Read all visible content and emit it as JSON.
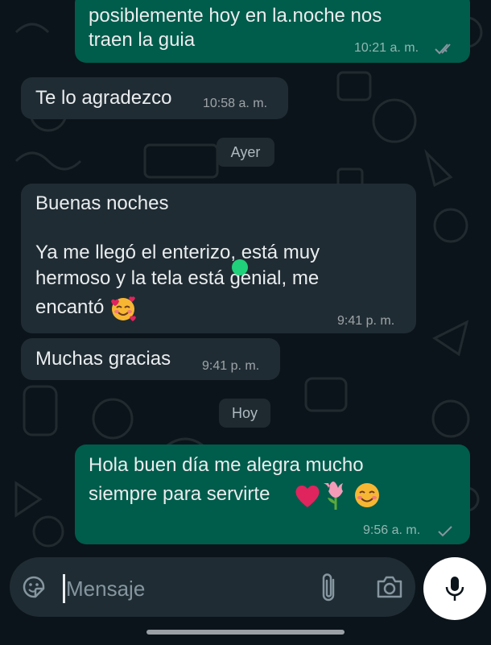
{
  "messages": [
    {
      "lines": [
        "posiblemente hoy en la.noche nos",
        "traen la guia"
      ],
      "time": "10:21 a. m.",
      "direction": "outgoing",
      "status": "read"
    },
    {
      "lines": [
        "Te lo agradezco"
      ],
      "time": "10:58 a. m.",
      "direction": "incoming"
    },
    {
      "lines": [
        "Buenas noches",
        "",
        "Ya me llegó el enterizo, está muy",
        "hermoso y la tela está genial, me",
        "encantó"
      ],
      "emoji": "smiling-face-with-hearts",
      "time": "9:41 p. m.",
      "direction": "incoming"
    },
    {
      "lines": [
        "Muchas gracias"
      ],
      "time": "9:41 p. m.",
      "direction": "incoming"
    },
    {
      "lines": [
        "Hola buen día me alegra mucho",
        "siempre para servirte"
      ],
      "emojis": [
        "red-heart",
        "tulip",
        "smiling-face"
      ],
      "time": "9:56 a. m.",
      "direction": "outgoing",
      "status": "delivered"
    }
  ],
  "date_separators": {
    "ayer": "Ayer",
    "hoy": "Hoy"
  },
  "input": {
    "placeholder": "Mensaje"
  },
  "icons": {
    "sticker": "sticker-icon",
    "attach": "paperclip-icon",
    "camera": "camera-icon",
    "mic": "microphone-icon"
  },
  "colors": {
    "outgoing_bubble": "#005c4b",
    "incoming_bubble": "#202c33",
    "background": "#0b141a",
    "read_ticks": "#8696a0"
  }
}
